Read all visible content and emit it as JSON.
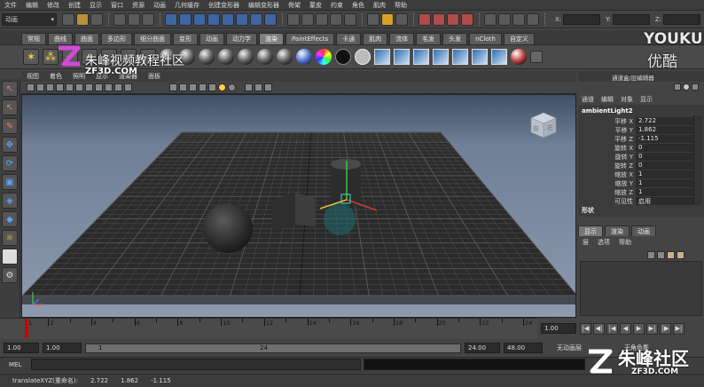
{
  "menubar": [
    "文件",
    "编辑",
    "修改",
    "创建",
    "显示",
    "窗口",
    "资源",
    "动画",
    "几何缓存",
    "创建变形器",
    "编辑变形器",
    "骨架",
    "蒙皮",
    "约束",
    "角色",
    "肌肉",
    "帮助"
  ],
  "mode_selector": "动画",
  "coord_fields": {
    "x_label": "X:",
    "y_label": "Y:",
    "z_label": "Z:"
  },
  "shelf_tabs": [
    {
      "label": "常规",
      "active": false
    },
    {
      "label": "曲线",
      "active": false
    },
    {
      "label": "曲面",
      "active": false
    },
    {
      "label": "多边形",
      "active": false
    },
    {
      "label": "细分曲面",
      "active": false
    },
    {
      "label": "变形",
      "active": false
    },
    {
      "label": "动画",
      "active": false
    },
    {
      "label": "动力学",
      "active": false
    },
    {
      "label": "渲染",
      "active": true
    },
    {
      "label": "PaintEffects",
      "active": false
    },
    {
      "label": "卡通",
      "active": false
    },
    {
      "label": "肌肉",
      "active": false
    },
    {
      "label": "流体",
      "active": false
    },
    {
      "label": "毛发",
      "active": false
    },
    {
      "label": "头发",
      "active": false
    },
    {
      "label": "nCloth",
      "active": false
    },
    {
      "label": "自定义",
      "active": false
    }
  ],
  "viewport_menu": [
    "视图",
    "着色",
    "照明",
    "显示",
    "渲染器",
    "面板"
  ],
  "view_cube": {
    "front": "前",
    "right": "右"
  },
  "channel_box": {
    "header": "通道盒/层编辑器",
    "menu": [
      "通道",
      "编辑",
      "对象",
      "显示"
    ],
    "object_name": "ambientLight2",
    "attributes": [
      {
        "name": "平移 X",
        "value": "2.722"
      },
      {
        "name": "平移 Y",
        "value": "1.862"
      },
      {
        "name": "平移 Z",
        "value": "-1.115"
      },
      {
        "name": "旋转 X",
        "value": "0"
      },
      {
        "name": "旋转 Y",
        "value": "0"
      },
      {
        "name": "旋转 Z",
        "value": "0"
      },
      {
        "name": "缩放 X",
        "value": "1"
      },
      {
        "name": "缩放 Y",
        "value": "1"
      },
      {
        "name": "缩放 Z",
        "value": "1"
      },
      {
        "name": "可见性",
        "value": "启用"
      }
    ],
    "shapes_label": "形状"
  },
  "layer_editor": {
    "tabs": [
      {
        "label": "显示",
        "active": true
      },
      {
        "label": "渲染",
        "active": false
      },
      {
        "label": "动画",
        "active": false
      }
    ],
    "menu": [
      "层",
      "选项",
      "帮助"
    ]
  },
  "time_slider": {
    "ticks": [
      1,
      2,
      4,
      6,
      8,
      10,
      12,
      14,
      16,
      18,
      20,
      22,
      24
    ],
    "current_frame": "1.00"
  },
  "range_slider": {
    "start_time": "1.00",
    "range_start": "1.00",
    "bar_start_label": "1",
    "bar_end_label": "24",
    "range_end": "24.00",
    "end_time": "48.00",
    "anim_layer": "无动画层",
    "char_set": "无角色集"
  },
  "mel_label": "MEL",
  "help_line": {
    "text": "translateXYZ(重命名):",
    "x": "2.722",
    "y": "1.862",
    "z": "-1.115"
  },
  "watermarks": {
    "top_left_title": "朱峰视频教程社区",
    "top_left_site": "ZF3D.COM",
    "youku_en": "YOUKU",
    "youku_cn": "优酷",
    "bottom_right_title": "朱峰社区",
    "bottom_right_site": "ZF3D.COM"
  }
}
